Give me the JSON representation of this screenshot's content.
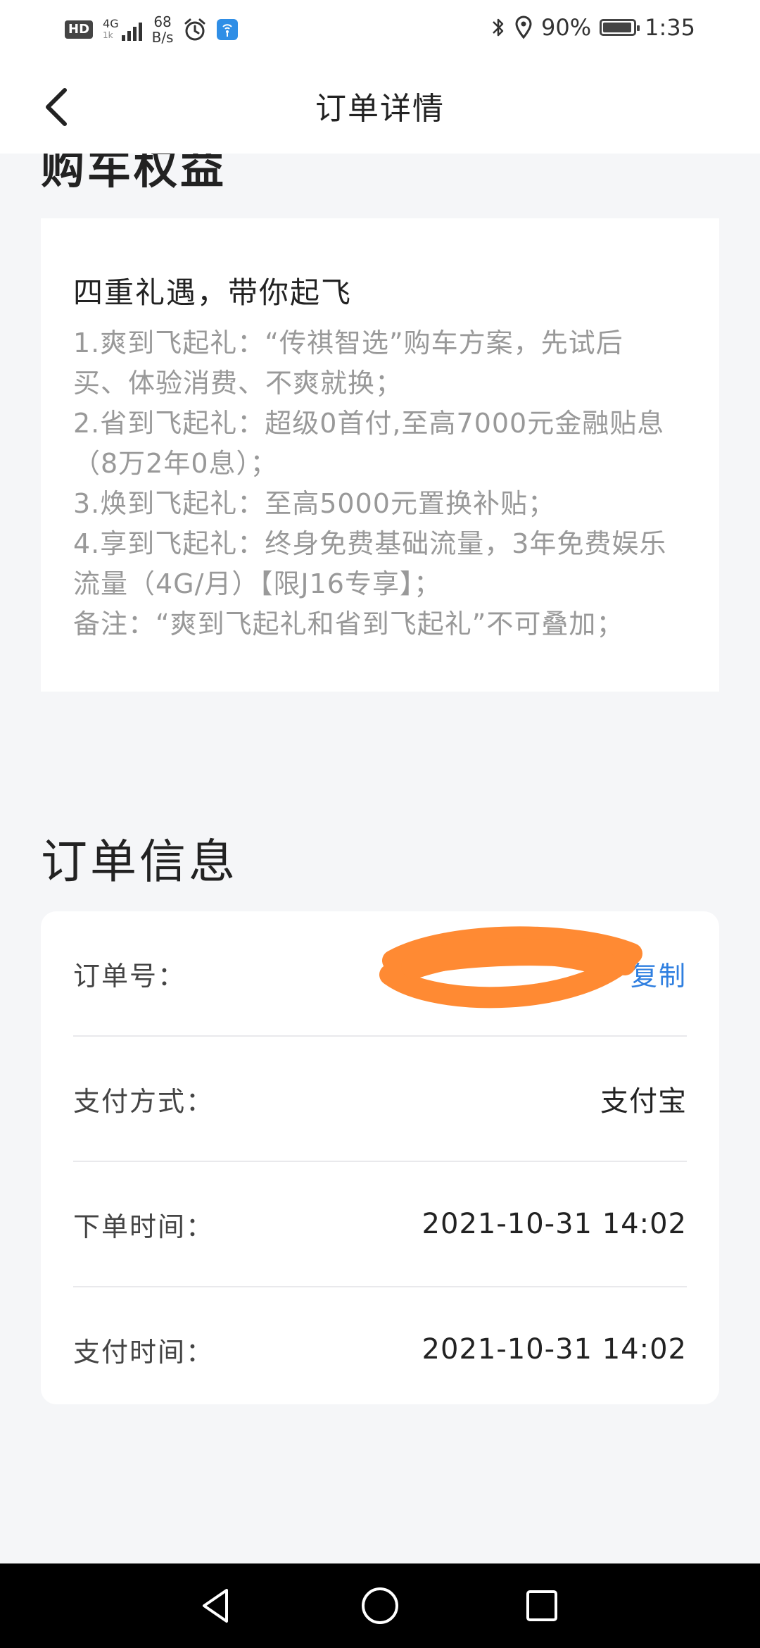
{
  "status_bar": {
    "hd": "HD",
    "net_type": "4G",
    "net_sub": "1k",
    "speed_value": "68",
    "speed_unit": "B/s",
    "battery_pct": "90%",
    "time": "1:35"
  },
  "header": {
    "title": "订单详情"
  },
  "benefits": {
    "section_title_partial": "购车权益",
    "card_title": "四重礼遇，带你起飞",
    "lines": [
      "1.爽到飞起礼：“传祺智选”购车方案，先试后",
      "买、体验消费、不爽就换；",
      "2.省到飞起礼：超级0首付,至高7000元金融贴息",
      "（8万2年0息）；",
      "3.焕到飞起礼：至高5000元置换补贴；",
      "4.享到飞起礼：终身免费基础流量，3年免费娱乐",
      "流量（4G/月）【限J16专享】；",
      "备注：“爽到飞起礼和省到飞起礼”不可叠加；"
    ]
  },
  "order_info": {
    "section_title": "订单信息",
    "order_no_label": "订单号：",
    "copy_label": "复制",
    "pay_method_label": "支付方式：",
    "pay_method_value": "支付宝",
    "order_time_label": "下单时间：",
    "order_time_value": "2021-10-31 14:02",
    "pay_time_label": "支付时间：",
    "pay_time_value": "2021-10-31 14:02"
  },
  "colors": {
    "accent": "#2f7fe0",
    "redaction": "#ff8a33",
    "background": "#f5f6f8"
  }
}
